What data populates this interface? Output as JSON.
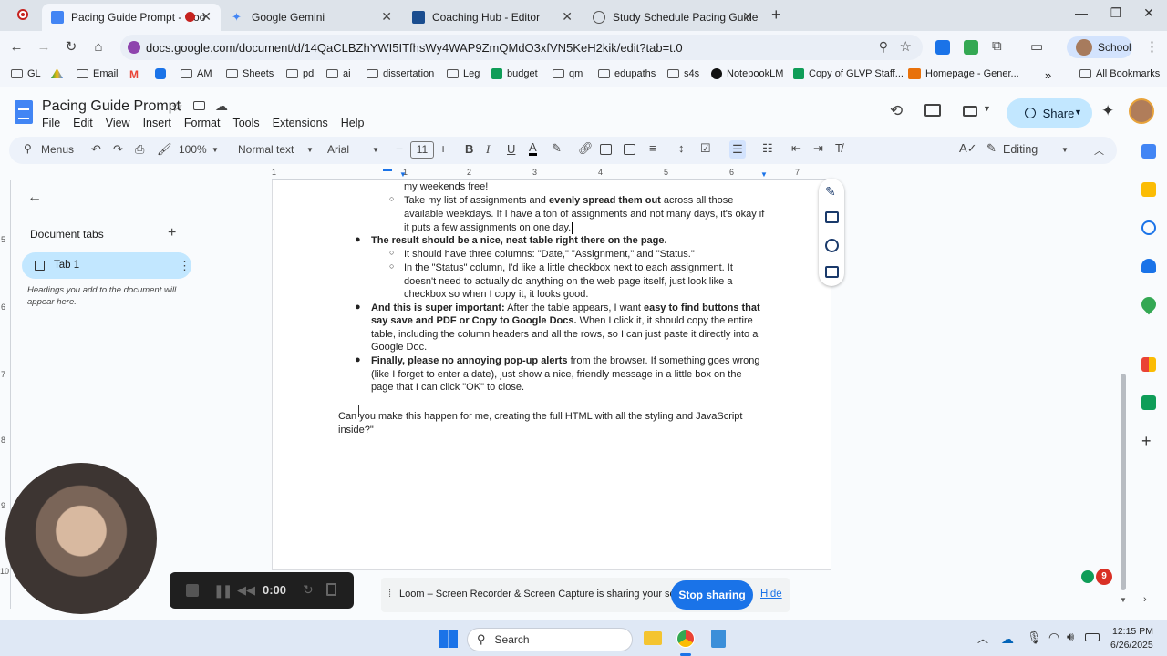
{
  "browser": {
    "tabs": [
      {
        "title": "Pacing Guide Prompt - Goo",
        "active": true
      },
      {
        "title": "Google Gemini",
        "active": false
      },
      {
        "title": "Coaching Hub - Editor",
        "active": false
      },
      {
        "title": "Study Schedule Pacing Guide",
        "active": false
      }
    ],
    "url": "docs.google.com/document/d/14QaCLBZhYWI5ITfhsWy4WAP9ZmQMdO3xfVN5KeH2kik/edit?tab=t.0",
    "profile_label": "School",
    "bookmarks": [
      "GL",
      "Email",
      "AM",
      "Sheets",
      "pd",
      "ai",
      "dissertation",
      "Leg",
      "budget",
      "qm",
      "edupaths",
      "s4s",
      "NotebookLM",
      "Copy of GLVP Staff...",
      "Homepage - Gener..."
    ],
    "all_bookmarks": "All Bookmarks"
  },
  "doc": {
    "title": "Pacing Guide Prompt",
    "menus": [
      "File",
      "Edit",
      "View",
      "Insert",
      "Format",
      "Tools",
      "Extensions",
      "Help"
    ],
    "share_label": "Share",
    "toolbar": {
      "menus_label": "Menus",
      "zoom": "100%",
      "style": "Normal text",
      "font": "Arial",
      "font_size": "11",
      "editing_label": "Editing"
    },
    "ruler_numbers": [
      "1",
      "1",
      "2",
      "3",
      "4",
      "5",
      "6",
      "7"
    ],
    "vruler_numbers": [
      "5",
      "6",
      "7",
      "8",
      "9",
      "10"
    ]
  },
  "sidebar": {
    "heading": "Document tabs",
    "tab_name": "Tab 1",
    "hint": "Headings you add to the document will appear here."
  },
  "content": {
    "l1": "my weekends free!",
    "l2a": "Take my list of assignments and ",
    "l2b": "evenly spread them out",
    "l2c": " across all those",
    "l3": "available weekdays. If I have a ton of assignments and not many days, it's okay if",
    "l4": "it puts a few assignments on one day.",
    "l5": "The result should be a nice, neat table right there on the page.",
    "l6": "It should have three columns: \"Date,\" \"Assignment,\" and \"Status.\"",
    "l7": "In the \"Status\" column, I'd like a little checkbox next to each assignment. It",
    "l8": "doesn't need to actually do anything on the web page itself, just look like a",
    "l9": "checkbox so when I copy it, it looks good.",
    "l10a": "And this is super important:",
    "l10b": " After the table appears, I want ",
    "l10c": "easy to find buttons that",
    "l11a": "say save and PDF or Copy to Google Docs.",
    "l11b": " When I click it, it should copy the entire",
    "l12": "table, including the column headers and all the rows, so I can just paste it directly into a",
    "l13": "Google Doc.",
    "l14a": "Finally, please no annoying pop-up alerts",
    "l14b": " from the browser. If something goes wrong",
    "l15": "(like I forget to enter a date), just show a nice, friendly message in a little box on the",
    "l16": "page that I can click \"OK\" to close.",
    "l17": "Can you make this happen for me, creating the full HTML with all the styling and JavaScript",
    "l18": "inside?\""
  },
  "loom": {
    "timer": "0:00",
    "message": "Loom – Screen Recorder & Screen Capture is sharing your screen.",
    "stop_label": "Stop sharing",
    "hide_label": "Hide"
  },
  "taskbar": {
    "search_label": "Search",
    "time": "12:15 PM",
    "date": "6/26/2025",
    "notif_count": "9"
  },
  "colors": {
    "accent": "#1a73e8",
    "share_bg": "#c2e7ff",
    "tab_active_bg": "#c2e7ff"
  }
}
